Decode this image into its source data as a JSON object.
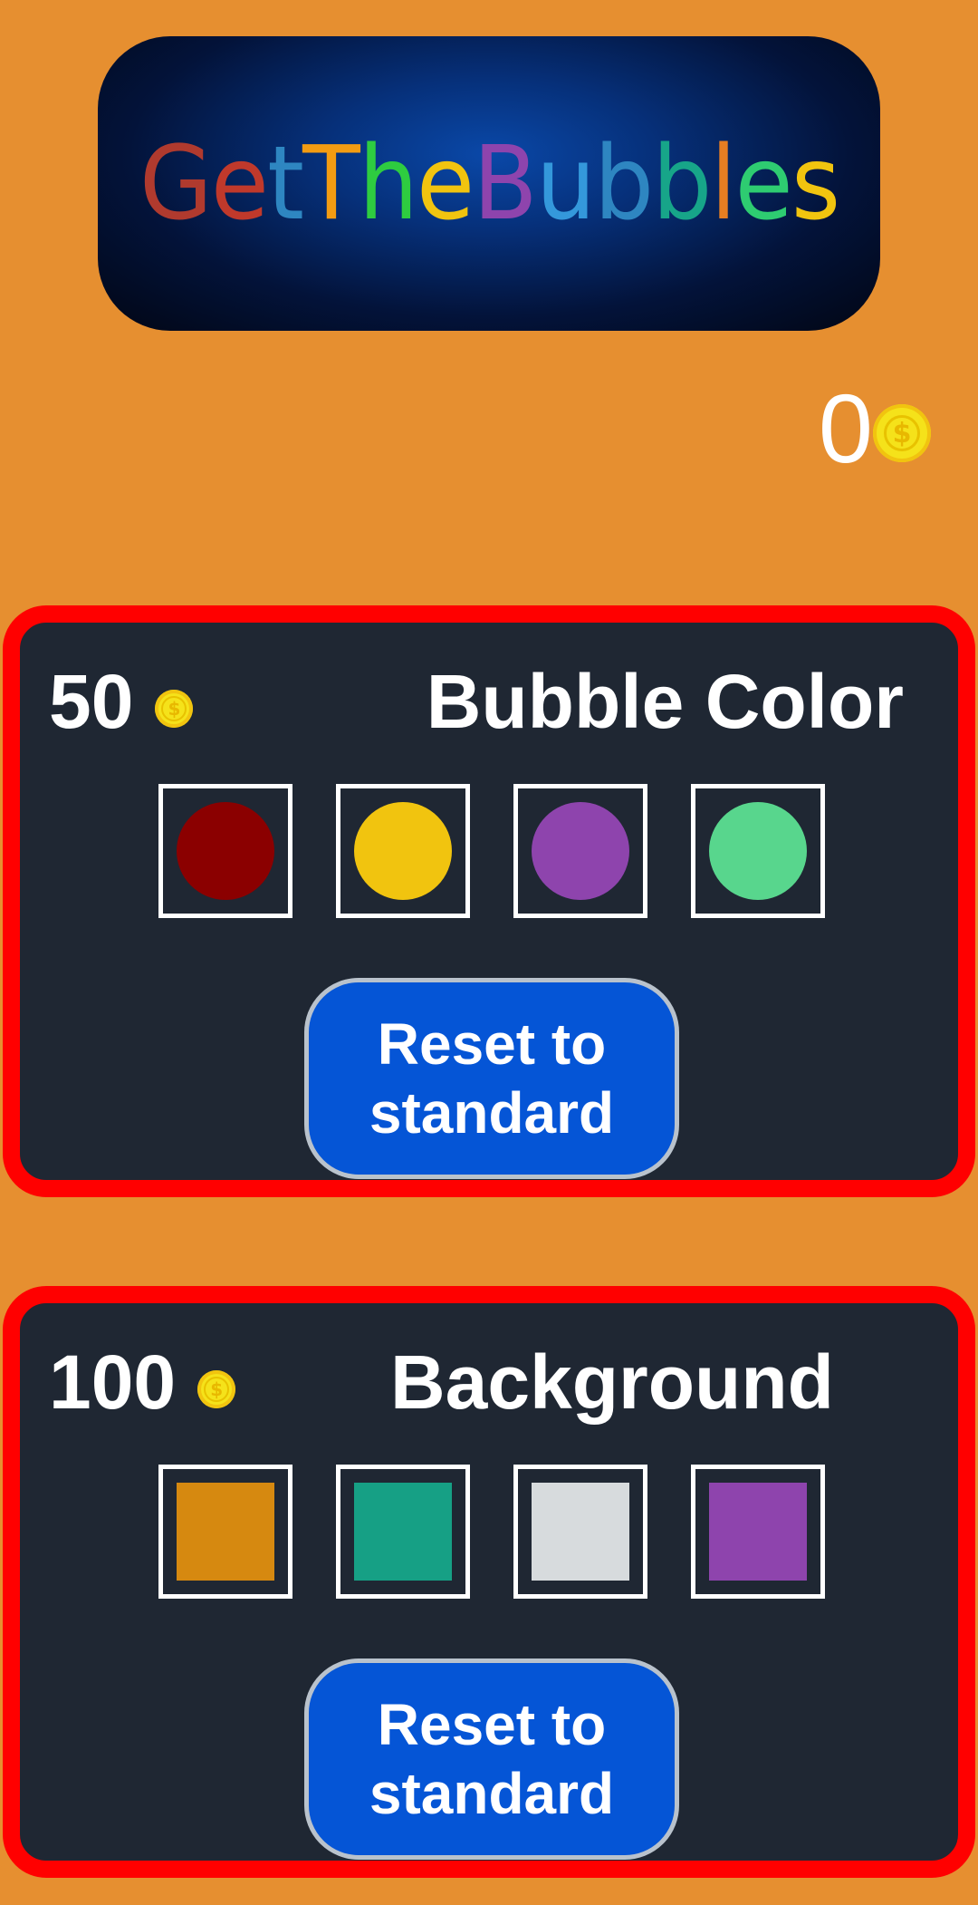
{
  "logo": {
    "letters": [
      {
        "char": "G",
        "color": "#b03a2e"
      },
      {
        "char": "e",
        "color": "#c0392b"
      },
      {
        "char": "t",
        "color": "#2e86c1"
      },
      {
        "char": "T",
        "color": "#f39c12"
      },
      {
        "char": "h",
        "color": "#2ecc40"
      },
      {
        "char": "e",
        "color": "#f1c40f"
      },
      {
        "char": "B",
        "color": "#8e44ad"
      },
      {
        "char": "u",
        "color": "#3498db"
      },
      {
        "char": "b",
        "color": "#2e86c1"
      },
      {
        "char": "b",
        "color": "#17a589"
      },
      {
        "char": "l",
        "color": "#e67e22"
      },
      {
        "char": "e",
        "color": "#2ecc71"
      },
      {
        "char": "s",
        "color": "#f1c40f"
      }
    ]
  },
  "wallet": {
    "coins": "0",
    "icon": "coin-icon"
  },
  "bubble_color": {
    "price": "50",
    "title": "Bubble Color",
    "options": [
      {
        "name": "bubble-color-dark-red",
        "color": "#8b0000"
      },
      {
        "name": "bubble-color-yellow",
        "color": "#f1c40f"
      },
      {
        "name": "bubble-color-purple",
        "color": "#8e44ad"
      },
      {
        "name": "bubble-color-green",
        "color": "#58d68d"
      }
    ],
    "reset_label": "Reset to standard"
  },
  "background": {
    "price": "100",
    "title": "Background",
    "options": [
      {
        "name": "background-orange",
        "color": "#d68910"
      },
      {
        "name": "background-teal",
        "color": "#16a085"
      },
      {
        "name": "background-light-gray",
        "color": "#d7dbdd"
      },
      {
        "name": "background-purple",
        "color": "#8e44ad"
      }
    ],
    "reset_label": "Reset to standard"
  },
  "colors": {
    "page_background": "#e68f30",
    "panel_background": "#1f2733",
    "panel_border": "#ff0000",
    "button_background": "#0555d6",
    "coin": "#f5e21a"
  }
}
